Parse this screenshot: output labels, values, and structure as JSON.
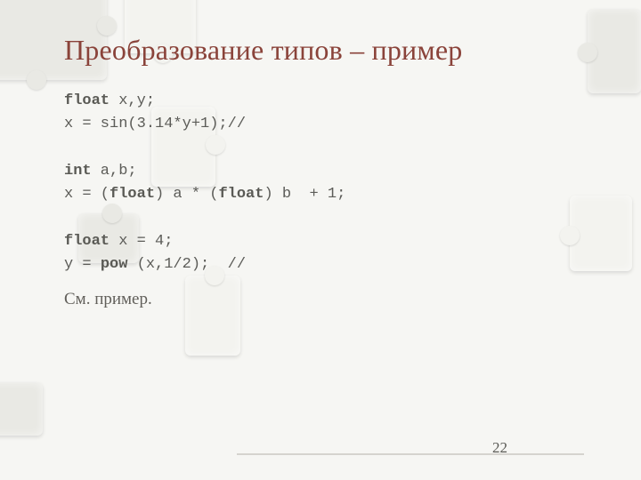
{
  "title": "Преобразование типов – пример",
  "code": {
    "l1": {
      "kw": "float",
      "rest": " x,y;"
    },
    "l2": "x = sin(3.14*y+1);//",
    "l3": {
      "kw": "int",
      "rest": " a,b;"
    },
    "l4": {
      "pre": "x = (",
      "kw1": "float",
      "mid": ") a * (",
      "kw2": "float",
      "post": ") b  + 1;"
    },
    "l5": {
      "kw": "float",
      "rest": " x = 4;"
    },
    "l6": {
      "pre": "y = ",
      "kw": "pow",
      "post": " (x,1/2);  //"
    }
  },
  "note": "См. пример.",
  "page_number": "22"
}
